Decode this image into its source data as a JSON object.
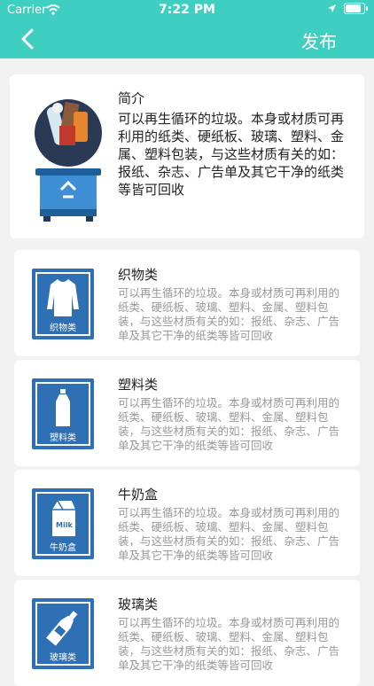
{
  "status_bar": {
    "carrier": "Carrier",
    "time": "7:22 PM"
  },
  "header": {
    "publish_label": "发布"
  },
  "intro": {
    "title": "简介",
    "text": "可以再生循环的垃圾。本身或材质可再利用的纸类、硬纸板、玻璃、塑料、金属、塑料包装，与这些材质有关的如：报纸、杂志、广告单及其它干净的纸类等皆可回收"
  },
  "categories": [
    {
      "title": "织物类",
      "icon_label": "织物类",
      "icon": "clothing-icon",
      "desc": "可以再生循环的垃圾。本身或材质可再利用的纸类、硬纸板、玻璃、塑料、金属、塑料包装，与这些材质有关的如：报纸、杂志、广告单及其它干净的纸类等皆可回收"
    },
    {
      "title": "塑料类",
      "icon_label": "塑料类",
      "icon": "plastic-bottle-icon",
      "desc": "可以再生循环的垃圾。本身或材质可再利用的纸类、硬纸板、玻璃、塑料、金属、塑料包装，与这些材质有关的如：报纸、杂志、广告单及其它干净的纸类等皆可回收"
    },
    {
      "title": "牛奶盒",
      "icon_label": "牛奶盒",
      "icon": "milk-carton-icon",
      "icon_text": "Milk",
      "desc": "可以再生循环的垃圾。本身或材质可再利用的纸类、硬纸板、玻璃、塑料、金属、塑料包装，与这些材质有关的如：报纸、杂志、广告单及其它干净的纸类等皆可回收"
    },
    {
      "title": "玻璃类",
      "icon_label": "玻璃类",
      "icon": "glass-bottle-icon",
      "desc": "可以再生循环的垃圾。本身或材质可再利用的纸类、硬纸板、玻璃、塑料、金属、塑料包装，与这些材质有关的如：报纸、杂志、广告单及其它干净的纸类等皆可回收"
    }
  ],
  "colors": {
    "header": "#3ecfc0",
    "category_icon_bg": "#2f6fb3",
    "bin": "#3f8fd6"
  }
}
